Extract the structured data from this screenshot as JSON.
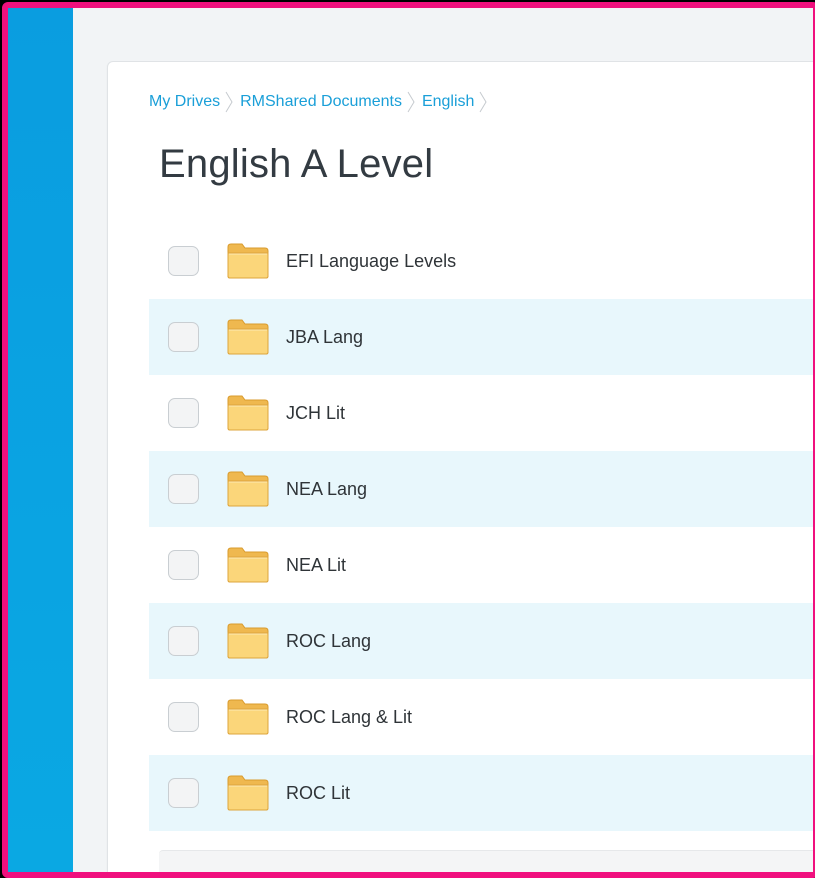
{
  "breadcrumb": {
    "items": [
      {
        "label": "My Drives"
      },
      {
        "label": "RMShared Documents"
      },
      {
        "label": "English"
      }
    ]
  },
  "page": {
    "title": "English A Level"
  },
  "folders": [
    {
      "name": "EFI Language Levels"
    },
    {
      "name": "JBA Lang"
    },
    {
      "name": "JCH Lit"
    },
    {
      "name": "NEA Lang"
    },
    {
      "name": "NEA Lit"
    },
    {
      "name": "ROC Lang"
    },
    {
      "name": "ROC Lang & Lit"
    },
    {
      "name": "ROC Lit"
    }
  ],
  "colors": {
    "frame_border": "#f0107e",
    "sidebar_accent": "#0aa4e2",
    "link": "#1a9fd8",
    "row_highlight": "#e8f7fc",
    "folder": "#f9cf6e"
  },
  "icons": {
    "folder": "folder-icon",
    "breadcrumb_separator": "chevron-right-icon"
  }
}
